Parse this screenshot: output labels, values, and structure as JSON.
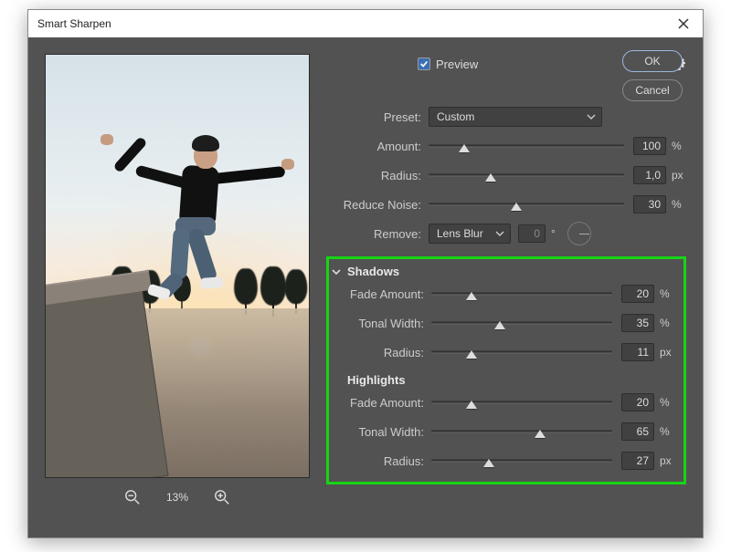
{
  "window": {
    "title": "Smart Sharpen"
  },
  "buttons": {
    "ok": "OK",
    "cancel": "Cancel"
  },
  "preview": {
    "label": "Preview",
    "checked": true
  },
  "zoom": {
    "level": "13%"
  },
  "preset": {
    "label": "Preset:",
    "value": "Custom"
  },
  "main": {
    "amount": {
      "label": "Amount:",
      "value": "100",
      "unit": "%",
      "pct": 18
    },
    "radius": {
      "label": "Radius:",
      "value": "1,0",
      "unit": "px",
      "pct": 32
    },
    "reduceNoise": {
      "label": "Reduce Noise:",
      "value": "30",
      "unit": "%",
      "pct": 45
    },
    "remove": {
      "label": "Remove:",
      "value": "Lens Blur",
      "angleValue": "0",
      "angleUnit": "°"
    }
  },
  "shadows": {
    "title": "Shadows",
    "fade": {
      "label": "Fade Amount:",
      "value": "20",
      "unit": "%",
      "pct": 22
    },
    "tonal": {
      "label": "Tonal Width:",
      "value": "35",
      "unit": "%",
      "pct": 38
    },
    "radius": {
      "label": "Radius:",
      "value": "11",
      "unit": "px",
      "pct": 22
    }
  },
  "highlights": {
    "title": "Highlights",
    "fade": {
      "label": "Fade Amount:",
      "value": "20",
      "unit": "%",
      "pct": 22
    },
    "tonal": {
      "label": "Tonal Width:",
      "value": "65",
      "unit": "%",
      "pct": 60
    },
    "radius": {
      "label": "Radius:",
      "value": "27",
      "unit": "px",
      "pct": 32
    }
  }
}
